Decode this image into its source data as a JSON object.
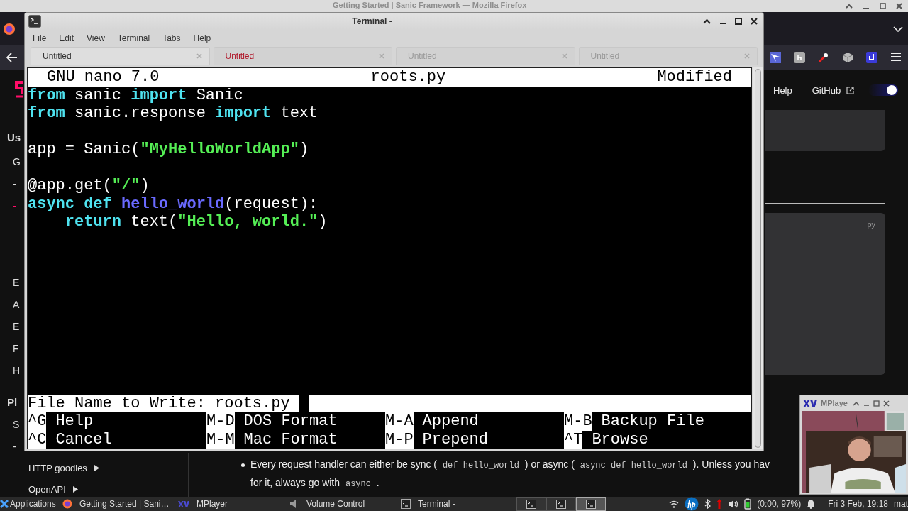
{
  "browser": {
    "title": "Getting Started | Sanic Framework — Mozilla Firefox",
    "nav": [
      {
        "label": "Help"
      },
      {
        "label": "GitHub"
      }
    ],
    "dark_mode_toggle": {
      "on": true
    },
    "sidebar": [
      {
        "text": "Us",
        "kind": "heading"
      },
      {
        "text": "G",
        "kind": "item"
      },
      {
        "text": "-",
        "kind": "item"
      },
      {
        "text": "-",
        "kind": "active"
      },
      {
        "text": "E",
        "kind": "item"
      },
      {
        "text": "A",
        "kind": "item"
      },
      {
        "text": "E",
        "kind": "item"
      },
      {
        "text": "F",
        "kind": "item"
      },
      {
        "text": "H",
        "kind": "item"
      },
      {
        "text": "Pl",
        "kind": "heading"
      },
      {
        "text": "S",
        "kind": "item"
      },
      {
        "text": "-",
        "kind": "item"
      }
    ],
    "sidebar_bottom": [
      {
        "label": "HTTP goodies"
      },
      {
        "label": "OpenAPI"
      }
    ],
    "code_card_lang": "py",
    "bullet": [
      {
        "text": "Every request handler can either be sync ( ",
        "kind": "text"
      },
      {
        "text": "def hello_world",
        "kind": "code"
      },
      {
        "text": " ) or async ( ",
        "kind": "text"
      },
      {
        "text": "async def hello_world",
        "kind": "code"
      },
      {
        "text": " ). Unless you hav",
        "kind": "text"
      }
    ],
    "bullet_line2": [
      {
        "text": "for it, always go with ",
        "kind": "text"
      },
      {
        "text": "async",
        "kind": "code"
      },
      {
        "text": " .",
        "kind": "text"
      }
    ]
  },
  "terminal": {
    "title": "Terminal -",
    "menu": [
      "File",
      "Edit",
      "View",
      "Terminal",
      "Tabs",
      "Help"
    ],
    "tabs": [
      {
        "label": "Untitled",
        "selected": true,
        "alert": false
      },
      {
        "label": "Untitled",
        "selected": false,
        "alert": true
      },
      {
        "label": "Untitled",
        "selected": false,
        "alert": false
      },
      {
        "label": "Untitled",
        "selected": false,
        "alert": false
      }
    ],
    "nano": {
      "version": "GNU nano 7.0",
      "filename": "roots.py",
      "status": "Modified",
      "lines": [
        {
          "kind": "code",
          "tokens": [
            {
              "text": "from",
              "kind": "keyword"
            },
            {
              "text": " sanic ",
              "kind": "plain"
            },
            {
              "text": "import",
              "kind": "keyword"
            },
            {
              "text": " Sanic",
              "kind": "plain"
            }
          ]
        },
        {
          "kind": "code",
          "tokens": [
            {
              "text": "from",
              "kind": "keyword"
            },
            {
              "text": " sanic.response ",
              "kind": "plain"
            },
            {
              "text": "import",
              "kind": "keyword"
            },
            {
              "text": " text",
              "kind": "plain"
            }
          ]
        },
        {
          "kind": "blank"
        },
        {
          "kind": "code",
          "tokens": [
            {
              "text": "app = Sanic(",
              "kind": "plain"
            },
            {
              "text": "\"MyHelloWorldApp\"",
              "kind": "string"
            },
            {
              "text": ")",
              "kind": "plain"
            }
          ]
        },
        {
          "kind": "blank"
        },
        {
          "kind": "code",
          "tokens": [
            {
              "text": "@app.get(",
              "kind": "plain"
            },
            {
              "text": "\"/\"",
              "kind": "string"
            },
            {
              "text": ")",
              "kind": "plain"
            }
          ]
        },
        {
          "kind": "code",
          "tokens": [
            {
              "text": "async def ",
              "kind": "keyword"
            },
            {
              "text": "hello_world",
              "kind": "function"
            },
            {
              "text": "(request):",
              "kind": "plain"
            }
          ]
        },
        {
          "kind": "code",
          "tokens": [
            {
              "text": "    return",
              "kind": "keyword"
            },
            {
              "text": " text(",
              "kind": "plain"
            },
            {
              "text": "\"Hello, world.\"",
              "kind": "string"
            },
            {
              "text": ")",
              "kind": "plain"
            }
          ]
        }
      ],
      "prompt": "File Name to Write: roots.py",
      "shortcuts": [
        [
          {
            "key": "^G",
            "label": "Help"
          },
          {
            "key": "M-D",
            "label": "DOS Format"
          },
          {
            "key": "M-A",
            "label": "Append"
          },
          {
            "key": "M-B",
            "label": "Backup File"
          }
        ],
        [
          {
            "key": "^C",
            "label": "Cancel"
          },
          {
            "key": "M-M",
            "label": "Mac Format"
          },
          {
            "key": "M-P",
            "label": "Prepend"
          },
          {
            "key": "^T",
            "label": "Browse"
          }
        ]
      ]
    }
  },
  "mplayer": {
    "title": "MPlaye"
  },
  "taskbar": {
    "start": "Applications",
    "tasks": [
      {
        "label": "Getting Started | Sani…",
        "kind": "firefox"
      },
      {
        "label": "MPlayer",
        "kind": "mplayer"
      },
      {
        "label": "Volume Control",
        "kind": "volume"
      },
      {
        "label": "Terminal -",
        "kind": "terminal"
      }
    ],
    "workspaces": [
      {
        "selected": false
      },
      {
        "selected": false
      },
      {
        "selected": true
      }
    ],
    "battery": "(0:00, 97%)",
    "clock": "Fri  3 Feb, 19:18",
    "user": "mat"
  }
}
